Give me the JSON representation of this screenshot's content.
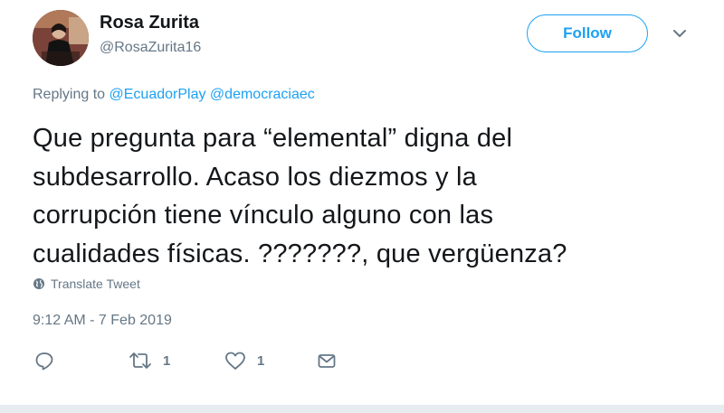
{
  "author": {
    "name": "Rosa Zurita",
    "handle": "@RosaZurita16"
  },
  "follow_button": {
    "label": "Follow"
  },
  "reply_context": {
    "prefix": "Replying to",
    "mentions": [
      "@EcuadorPlay",
      "@democraciaec"
    ]
  },
  "tweet": {
    "lines": [
      "Que pregunta para “elemental” digna del",
      "subdesarrollo. Acaso los diezmos y la",
      "corrupción tiene vínculo alguno con las",
      "cualidades físicas. ???????, que vergüenza?"
    ],
    "translate_label": "Translate Tweet",
    "timestamp": "9:12 AM - 7 Feb 2019"
  },
  "actions": {
    "reply": {
      "icon": "reply-icon",
      "count": ""
    },
    "retweet": {
      "icon": "retweet-icon",
      "count": "1"
    },
    "like": {
      "icon": "heart-icon",
      "count": "1"
    },
    "dm": {
      "icon": "envelope-icon",
      "count": ""
    }
  },
  "colors": {
    "accent": "#1da1f2",
    "text": "#14171a",
    "secondary": "#657786"
  }
}
